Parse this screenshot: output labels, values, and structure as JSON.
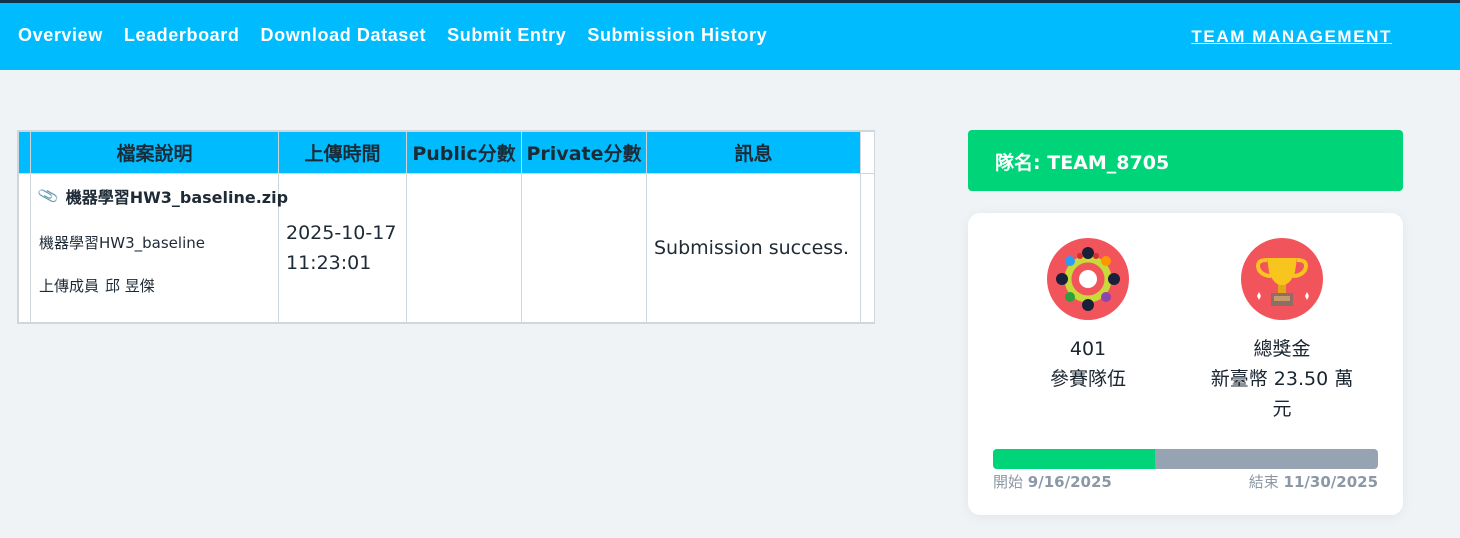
{
  "nav": {
    "items": [
      "Overview",
      "Leaderboard",
      "Download Dataset",
      "Submit Entry",
      "Submission History"
    ],
    "team_management": "TEAM MANAGEMENT"
  },
  "table": {
    "headers": [
      "檔案說明",
      "上傳時間",
      "Public分數",
      "Private分數",
      "訊息"
    ],
    "rows": [
      {
        "file_name": "機器學習HW3_baseline.zip",
        "description": "機器學習HW3_baseline",
        "uploader_label": "上傳成員",
        "uploader_name": "邱 昱傑",
        "upload_date": "2025-10-17",
        "upload_time": "11:23:01",
        "public_score": "",
        "private_score": "",
        "message": "Submission success."
      }
    ]
  },
  "team": {
    "label": "隊名:",
    "name": "TEAM_8705"
  },
  "stats": {
    "teams_count": "401",
    "teams_label": "參賽隊伍",
    "prize_label": "總獎金",
    "prize_value_line1": "新臺幣 23.50 萬",
    "prize_value_line2": "元"
  },
  "timeline": {
    "start_label": "開始",
    "start_date": "9/16/2025",
    "end_label": "結束",
    "end_date": "11/30/2025",
    "progress_fraction": 0.42
  },
  "icons": {
    "teams": "teamwork-icon",
    "prize": "trophy-icon",
    "attachment": "paperclip-icon"
  },
  "colors": {
    "accent": "#00bcff",
    "green": "#00d478",
    "badge_red": "#f2545b"
  }
}
